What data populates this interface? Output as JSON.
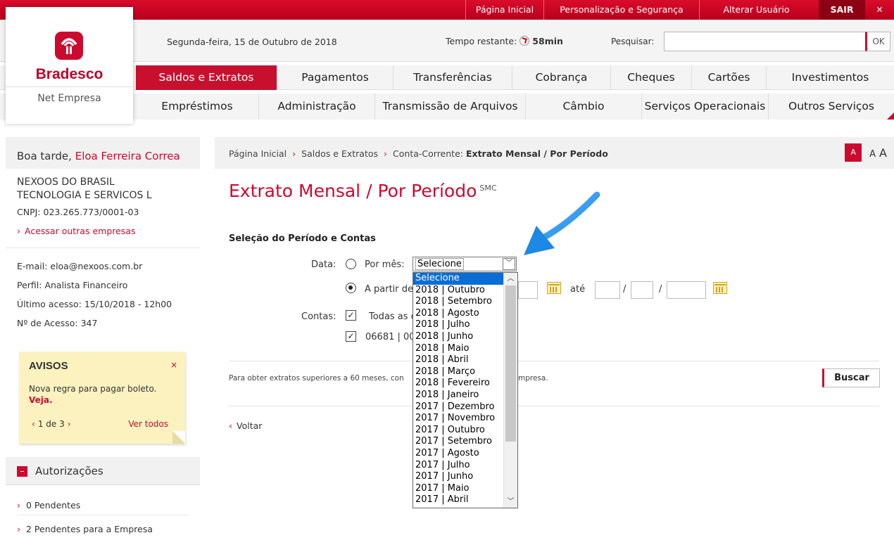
{
  "topbar": {
    "links": [
      "Página Inicial",
      "Personalização e Segurança",
      "Alterar Usuário"
    ],
    "logout": "SAIR",
    "close": "✕"
  },
  "brand": {
    "name": "Bradesco",
    "product": "Net Empresa"
  },
  "info": {
    "date": "Segunda-feira, 15 de Outubro de 2018",
    "time_label": "Tempo restante:",
    "time_value": "58min",
    "search_label": "Pesquisar:",
    "search_value": "",
    "ok": "OK"
  },
  "nav": {
    "row1": [
      "Saldos e Extratos",
      "Pagamentos",
      "Transferências",
      "Cobrança",
      "Cheques",
      "Cartões",
      "Investimentos"
    ],
    "row2": [
      "Empréstimos",
      "Administração",
      "Transmissão de Arquivos",
      "Câmbio",
      "Serviços Operacionais",
      "Outros Serviços"
    ],
    "active": "Saldos e Extratos"
  },
  "sidebar": {
    "greeting": "Boa tarde,",
    "user": "Eloa Ferreira Correa",
    "company": "NEXOOS DO BRASIL TECNOLOGIA E SERVICOS L",
    "cnpj": "CNPJ: 023.265.773/0001-03",
    "other": "Acessar outras empresas",
    "email": "E-mail: eloa@nexoos.com.br",
    "profile": "Perfil: Analista Financeiro",
    "last": "Último acesso: 15/10/2018 - 12h00",
    "access": "Nº de Acesso: 347",
    "avisos": {
      "title": "AVISOS",
      "close": "×",
      "msg": "Nova regra para pagar boleto.",
      "link": "Veja.",
      "pager": "1 de 3",
      "all": "Ver todos"
    },
    "auth": {
      "title": "Autorizações",
      "items": [
        "0 Pendentes",
        "2 Pendentes para a Empresa"
      ]
    }
  },
  "crumb": {
    "items": [
      "Página Inicial",
      "Saldos e Extratos"
    ],
    "prefix": "Conta-Corrente:",
    "current": "Extrato Mensal / Por Período",
    "sizes": [
      "A",
      "A",
      "A"
    ]
  },
  "page": {
    "title": "Extrato Mensal / Por Período",
    "sup": "SMC",
    "section": "Seleção do Período e Contas",
    "data_label": "Data:",
    "por_mes": "Por mês:",
    "a_partir": "A partir de",
    "ate": "até",
    "contas_label": "Contas:",
    "todas": "Todas as c",
    "conta": "06681 | 00",
    "select_value": "Selecione",
    "note_a": "Para obter extratos superiores a 60 meses, con",
    "note_b": "a empresa.",
    "buscar": "Buscar",
    "voltar": "Voltar"
  },
  "dropdown": {
    "options": [
      "Selecione",
      "2018 | Outubro",
      "2018 | Setembro",
      "2018 | Agosto",
      "2018 | Julho",
      "2018 | Junho",
      "2018 | Maio",
      "2018 | Abril",
      "2018 | Março",
      "2018 | Fevereiro",
      "2018 | Janeiro",
      "2017 | Dezembro",
      "2017 | Novembro",
      "2017 | Outubro",
      "2017 | Setembro",
      "2017 | Agosto",
      "2017 | Julho",
      "2017 | Junho",
      "2017 | Maio",
      "2017 | Abril"
    ],
    "selected_index": 0
  },
  "colors": {
    "brand": "#cc092f",
    "selection": "#0a6dd6",
    "arrow": "#1e90ff"
  }
}
